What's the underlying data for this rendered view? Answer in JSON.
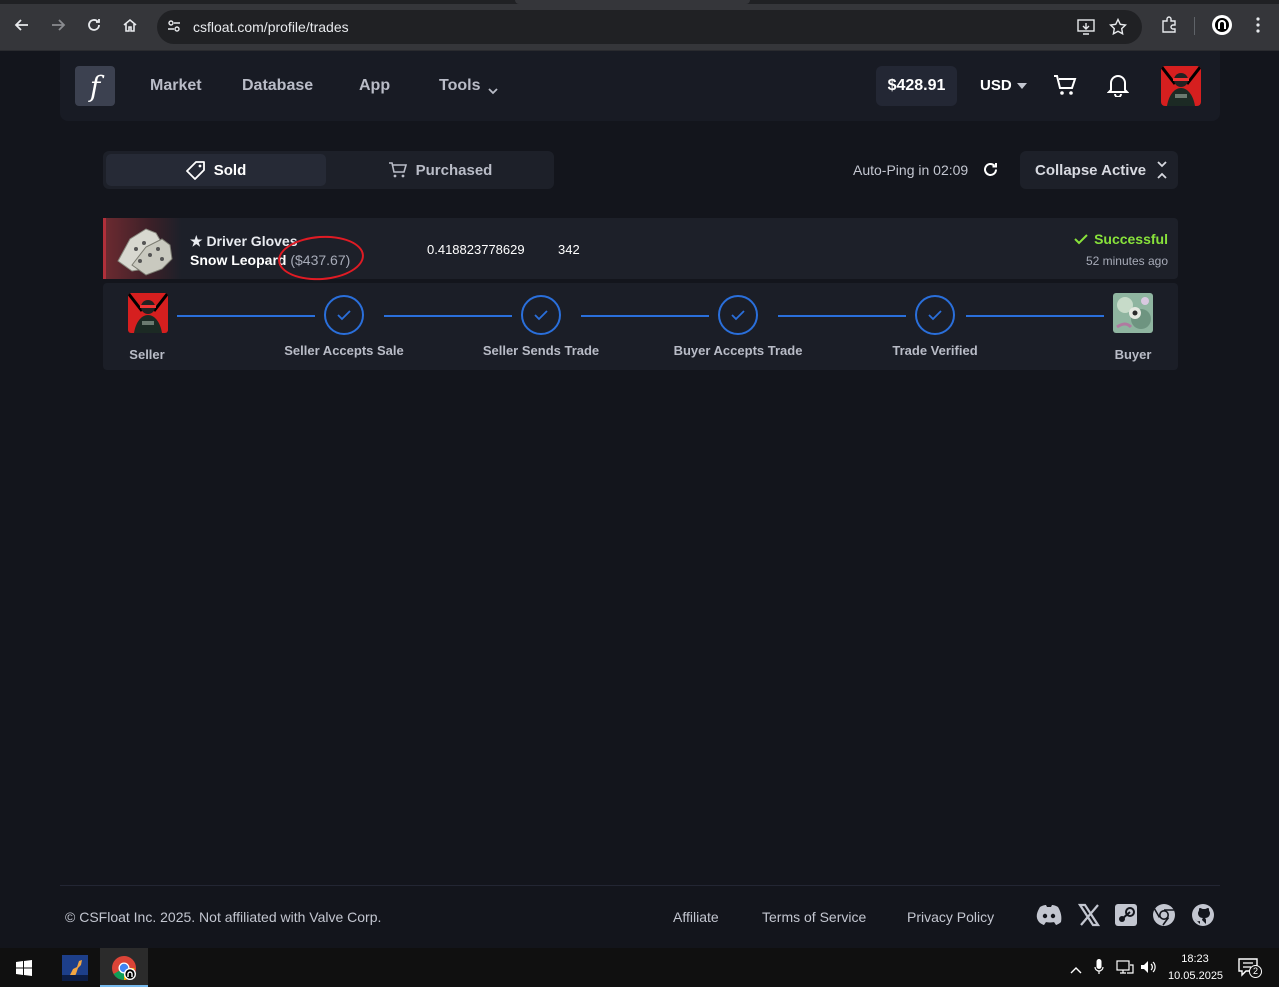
{
  "browser": {
    "url": "csfloat.com/profile/trades"
  },
  "header": {
    "logo": "f",
    "nav": [
      "Market",
      "Database",
      "App",
      "Tools"
    ],
    "balance": "$428.91",
    "currency": "USD"
  },
  "tabs": {
    "sold": "Sold",
    "purchased": "Purchased"
  },
  "toolbar": {
    "autoping": "Auto-Ping in 02:09",
    "collapse": "Collapse Active"
  },
  "trade": {
    "name_line1": "★ Driver Gloves",
    "name_line2": "Snow Leopard",
    "price": "($437.67)",
    "float": "0.418823778629",
    "seed": "342",
    "status": "Successful",
    "time_ago": "52 minutes ago"
  },
  "tracker": {
    "seller": "Seller",
    "steps": [
      "Seller Accepts Sale",
      "Seller Sends Trade",
      "Buyer Accepts Trade",
      "Trade Verified"
    ],
    "buyer": "Buyer"
  },
  "footer": {
    "copyright": "© CSFloat Inc. 2025. Not affiliated with Valve Corp.",
    "links": [
      "Affiliate",
      "Terms of Service",
      "Privacy Policy"
    ],
    "social_icons": [
      "discord-icon",
      "x-icon",
      "steam-icon",
      "chrome-icon",
      "github-icon"
    ]
  },
  "taskbar": {
    "time": "18:23",
    "date": "10.05.2025",
    "notifications": "2"
  },
  "colors": {
    "accent_blue": "#2a6fdb",
    "success_green": "#88e23b",
    "annotation_red": "#e01b24"
  }
}
